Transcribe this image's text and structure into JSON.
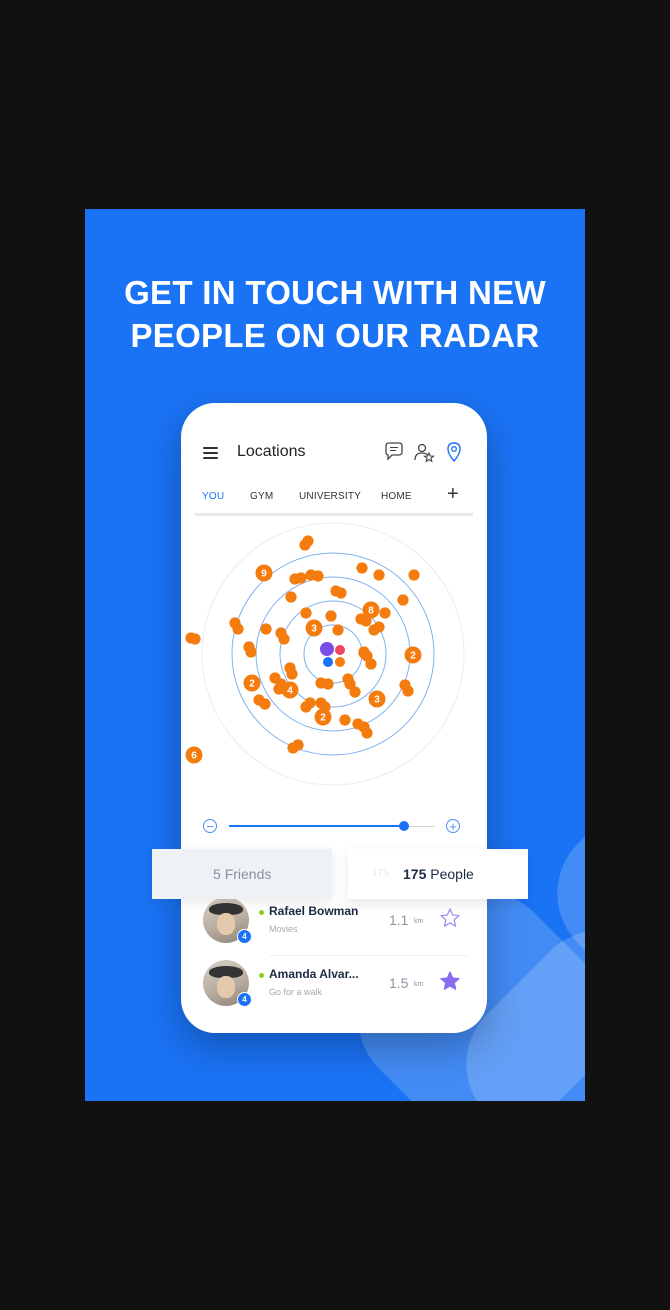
{
  "headline": {
    "line1": "GET IN TOUCH WITH NEW",
    "line2": "PEOPLE ON OUR RADAR"
  },
  "app": {
    "title": "Locations",
    "icons": [
      "menu-icon",
      "chat-icon",
      "people-star-icon",
      "location-pin-icon"
    ]
  },
  "tabs": [
    {
      "label": "YOU",
      "active": true
    },
    {
      "label": "GYM",
      "active": false
    },
    {
      "label": "UNIVERSITY",
      "active": false
    },
    {
      "label": "HOME",
      "active": false
    }
  ],
  "tab_add_label": "+",
  "radar": {
    "cluster_labels": [
      "9",
      "8",
      "3",
      "2",
      "2",
      "4",
      "3",
      "2",
      "6"
    ],
    "dot_color": "#f47c0f",
    "ring_color": "#7fb0f2"
  },
  "slider": {
    "minus_label": "−",
    "plus_label": "+",
    "value": 0.85
  },
  "segments": {
    "friends_count": "5",
    "friends_label": "Friends",
    "people_count": "175",
    "people_label": "People",
    "ghost_count": "175"
  },
  "people": [
    {
      "name": "Rafael Bowman",
      "activity": "Movies",
      "distance": "1.1",
      "unit": "km",
      "badge": "4",
      "favorite": false
    },
    {
      "name": "Amanda Alvar...",
      "activity": "Go for a walk",
      "distance": "1.5",
      "unit": "km",
      "badge": "4",
      "favorite": true
    }
  ],
  "colors": {
    "brand_blue": "#1a73f5",
    "accent_orange": "#f47c0f",
    "star_purple": "#8a6cf0",
    "online_green": "#7ed321"
  }
}
